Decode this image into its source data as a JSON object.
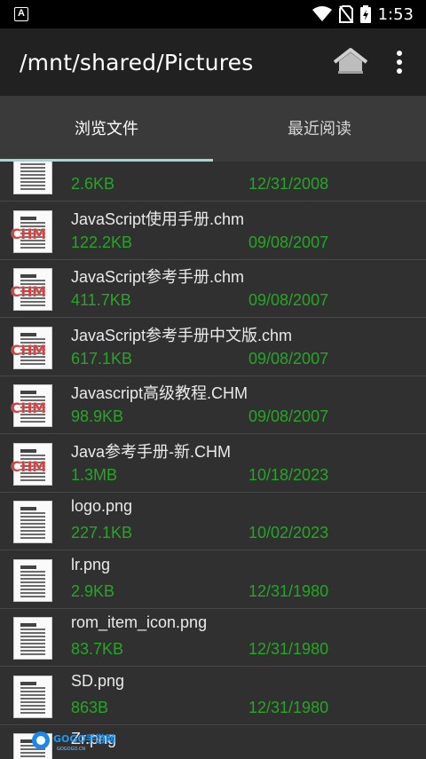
{
  "status_bar": {
    "time": "1:53",
    "notification_icon": "app-notification-icon",
    "icons": [
      "wifi-icon",
      "no-sim-icon",
      "battery-charging-icon"
    ]
  },
  "toolbar": {
    "title": "/mnt/shared/Pictures",
    "home_icon": "home-icon",
    "menu_icon": "overflow-menu-icon"
  },
  "tabs": [
    {
      "label": "浏览文件",
      "selected": true
    },
    {
      "label": "最近阅读",
      "selected": false
    }
  ],
  "files": [
    {
      "name": "",
      "size": "2.6KB",
      "date": "12/31/2008",
      "type": "doc"
    },
    {
      "name": "JavaScript使用手册.chm",
      "size": "122.2KB",
      "date": "09/08/2007",
      "type": "chm"
    },
    {
      "name": "JavaScript参考手册.chm",
      "size": "411.7KB",
      "date": "09/08/2007",
      "type": "chm"
    },
    {
      "name": "JavaScript参考手册中文版.chm",
      "size": "617.1KB",
      "date": "09/08/2007",
      "type": "chm"
    },
    {
      "name": "Javascript高级教程.CHM",
      "size": "98.9KB",
      "date": "09/08/2007",
      "type": "chm"
    },
    {
      "name": "Java参考手册-新.CHM",
      "size": "1.3MB",
      "date": "10/18/2023",
      "type": "chm"
    },
    {
      "name": "logo.png",
      "size": "227.1KB",
      "date": "10/02/2023",
      "type": "doc"
    },
    {
      "name": "lr.png",
      "size": "2.9KB",
      "date": "12/31/1980",
      "type": "doc"
    },
    {
      "name": "rom_item_icon.png",
      "size": "83.7KB",
      "date": "12/31/1980",
      "type": "doc"
    },
    {
      "name": "SD.png",
      "size": "863B",
      "date": "12/31/1980",
      "type": "doc"
    },
    {
      "name": "Zr.png",
      "size": "",
      "date": "",
      "type": "doc"
    }
  ],
  "chm_badge": "CHM",
  "watermark": {
    "text": "GOGO手游网",
    "url": "GOGOGO.CN"
  },
  "colors": {
    "background": "#303030",
    "toolbar": "#212121",
    "tabs": "#3a3a3a",
    "tab_indicator": "#9fd9cf",
    "meta_text": "#26a626",
    "chm_badge": "#d64040"
  }
}
